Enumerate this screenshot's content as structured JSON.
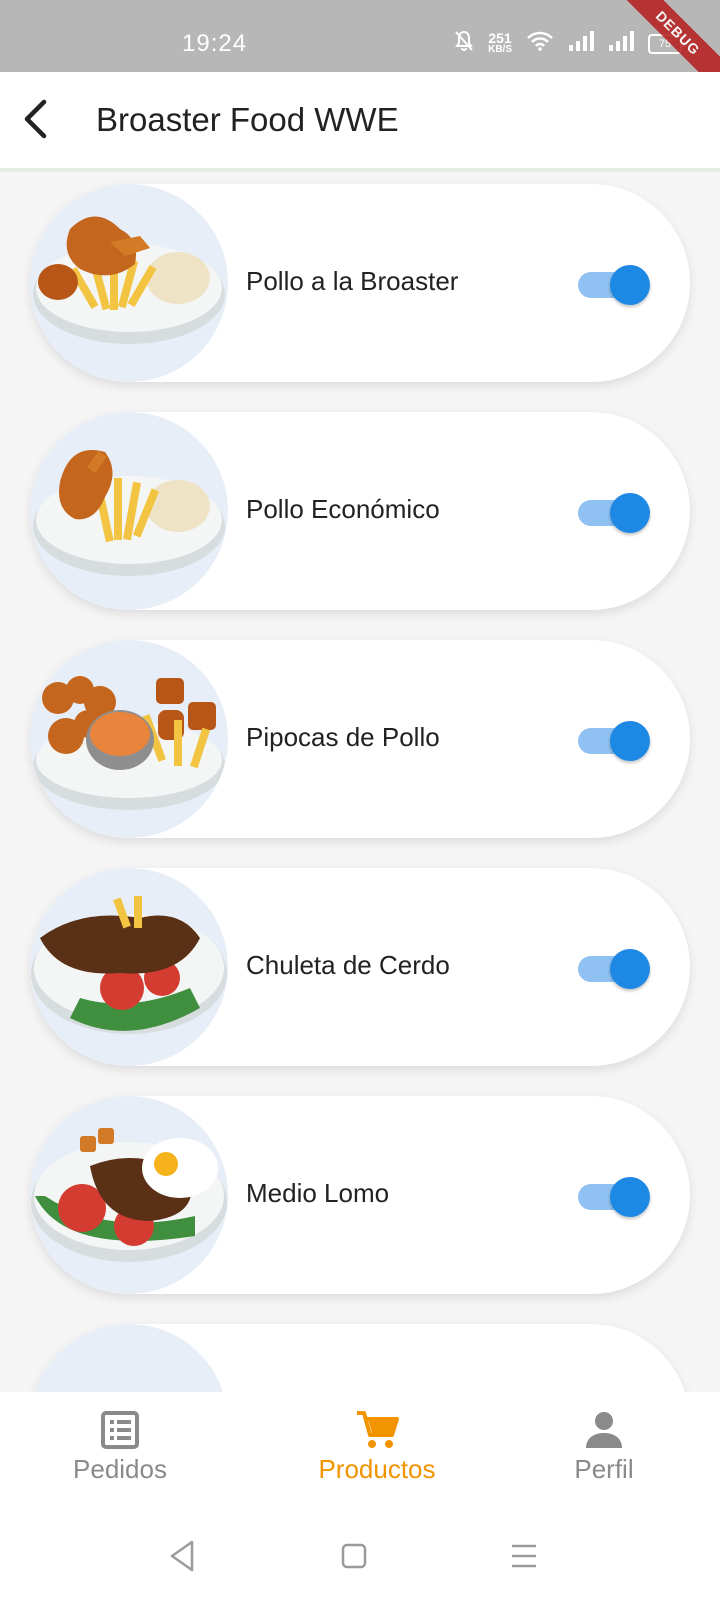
{
  "status_bar": {
    "time": "19:24",
    "net_speed_value": "251",
    "net_speed_unit": "KB/S",
    "battery": "75",
    "icons": [
      "bell-off-icon",
      "wifi-icon",
      "signal-icon",
      "signal-icon",
      "battery-icon"
    ],
    "debug_banner": "DEBUG"
  },
  "app_bar": {
    "back_icon": "arrow-back-icon",
    "title": "Broaster Food WWE"
  },
  "products": [
    {
      "name": "Pollo a la Broaster",
      "enabled": true
    },
    {
      "name": "Pollo Económico",
      "enabled": true
    },
    {
      "name": "Pipocas de Pollo",
      "enabled": true
    },
    {
      "name": "Chuleta de Cerdo",
      "enabled": true
    },
    {
      "name": "Medio Lomo",
      "enabled": true
    },
    {
      "name": "",
      "enabled": true
    }
  ],
  "bottom_nav": {
    "items": [
      {
        "label": "Pedidos",
        "icon": "list-alt-icon",
        "active": false
      },
      {
        "label": "Productos",
        "icon": "shopping-cart-icon",
        "active": true
      },
      {
        "label": "Perfil",
        "icon": "person-icon",
        "active": false
      }
    ]
  },
  "colors": {
    "accent": "#1e88e5",
    "active_nav": "#f29400",
    "inactive_nav": "#8a8a8a",
    "status_bar": "#b7b7b7"
  }
}
